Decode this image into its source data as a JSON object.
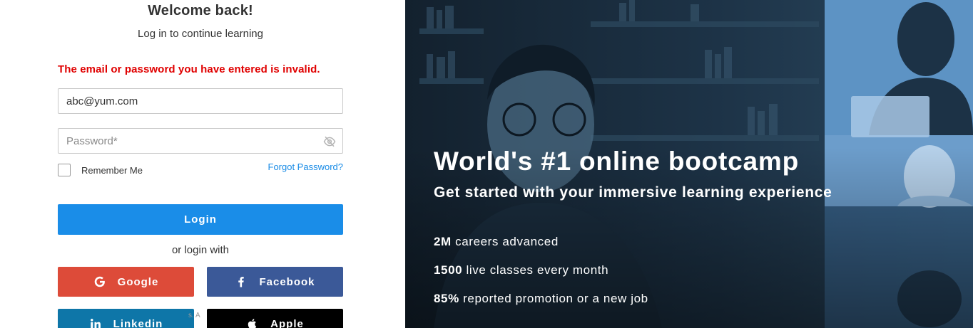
{
  "login": {
    "title": "Welcome back!",
    "subtitle": "Log in to continue learning",
    "error": "The email or password you have entered is invalid.",
    "email_value": "abc@yum.com",
    "password_placeholder": "Password*",
    "remember_label": "Remember Me",
    "forgot_label": "Forgot Password?",
    "login_label": "Login",
    "or_text": "or login with",
    "social": {
      "google": "Google",
      "facebook": "Facebook",
      "linkedin": "Linkedin",
      "apple": "Apple"
    },
    "faint_text": "s. A",
    "icons": [
      "eye-off-icon",
      "google-icon",
      "facebook-icon",
      "linkedin-icon",
      "apple-icon"
    ]
  },
  "hero": {
    "title": "World's #1 online bootcamp",
    "subtitle": "Get started with your immersive learning experience",
    "stats": [
      {
        "value": "2M",
        "label": " careers advanced"
      },
      {
        "value": "1500",
        "label": " live classes every month"
      },
      {
        "value": "85%",
        "label": " reported promotion or a new job"
      }
    ]
  },
  "colors": {
    "error": "#e00000",
    "link": "#1a8ce6",
    "login_button": "#1a8de8",
    "google": "#dd4b39",
    "facebook": "#3b5998",
    "linkedin": "#0e76a8",
    "apple": "#000000",
    "hero_overlay": "#1d3448"
  }
}
